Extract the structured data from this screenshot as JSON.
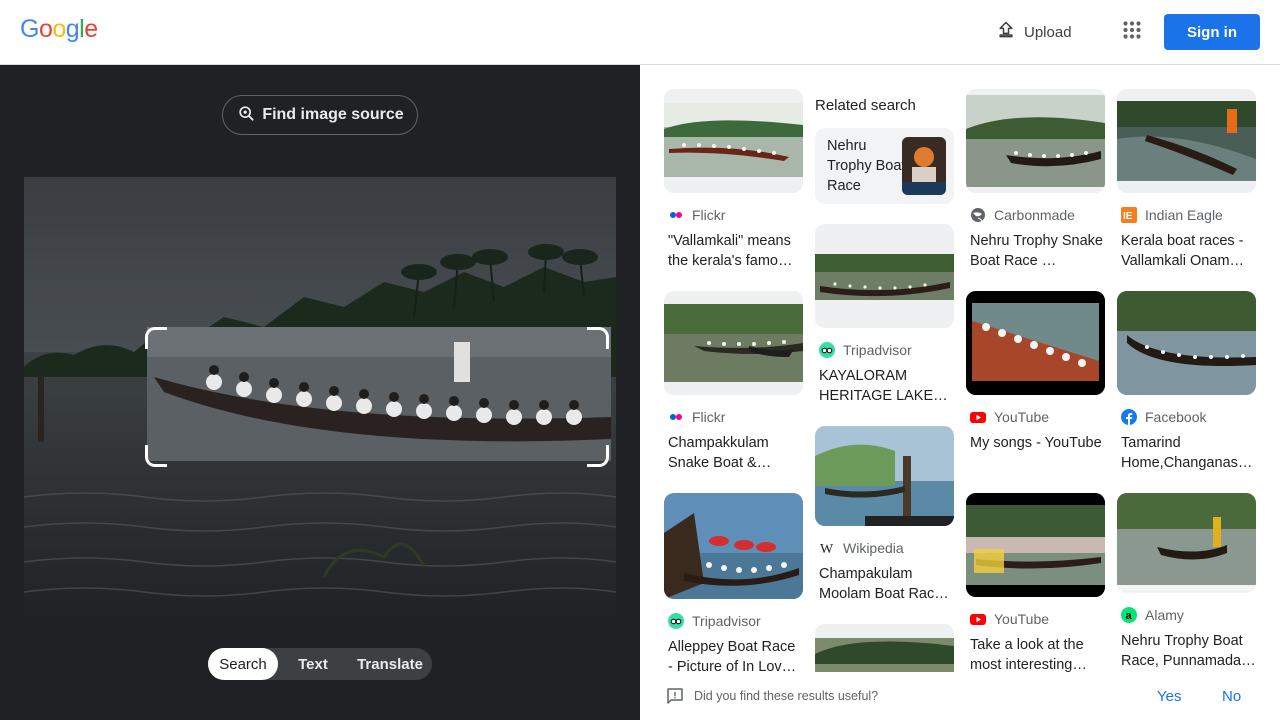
{
  "header": {
    "logo_letters": [
      {
        "ch": "G",
        "color": "#4285f4"
      },
      {
        "ch": "o",
        "color": "#ea4335"
      },
      {
        "ch": "o",
        "color": "#fbbc05"
      },
      {
        "ch": "g",
        "color": "#4285f4"
      },
      {
        "ch": "l",
        "color": "#34a853"
      },
      {
        "ch": "e",
        "color": "#ea4335"
      }
    ],
    "upload_label": "Upload",
    "upload_icon": "upload-icon",
    "apps_icon": "apps-grid-icon",
    "signin_label": "Sign in"
  },
  "left": {
    "find_source_label": "Find image source",
    "find_source_icon": "lens-search-icon",
    "tabs": [
      {
        "label": "Search",
        "active": true
      },
      {
        "label": "Text",
        "active": false
      },
      {
        "label": "Translate",
        "active": false
      }
    ]
  },
  "results": {
    "related_heading": "Related search",
    "related_chip": "Nehru Trophy Boat Race",
    "col1": [
      {
        "source": "Flickr",
        "icon": "flickr-icon",
        "title": "\"Vallamkali\" means the kerala's famo…"
      },
      {
        "source": "Flickr",
        "icon": "flickr-icon",
        "title": "Champakkulam Snake Boat &…"
      },
      {
        "source": "Tripadvisor",
        "icon": "tripadvisor-icon",
        "title": "Alleppey Boat Race - Picture of In Lov…"
      }
    ],
    "col2": [
      {
        "source": "Tripadvisor",
        "icon": "tripadvisor-icon",
        "title": "KAYALORAM HERITAGE LAKE…"
      },
      {
        "source": "Wikipedia",
        "icon": "wikipedia-icon",
        "title": "Champakulam Moolam Boat Rac…"
      }
    ],
    "col3": [
      {
        "source": "Carbonmade",
        "icon": "globe-icon",
        "title": "Nehru Trophy Snake Boat Race …"
      },
      {
        "source": "YouTube",
        "icon": "youtube-icon",
        "title": "My songs - YouTube"
      },
      {
        "source": "YouTube",
        "icon": "youtube-icon",
        "title": "Take a look at the most interesting…"
      }
    ],
    "col4": [
      {
        "source": "Indian Eagle",
        "icon": "indian-eagle-icon",
        "title": "Kerala boat races - Vallamkali Onam…"
      },
      {
        "source": "Facebook",
        "icon": "facebook-icon",
        "title": "Tamarind Home,Changanas…"
      },
      {
        "source": "Alamy",
        "icon": "alamy-icon",
        "title": "Nehru Trophy Boat Race, Punnamada…"
      }
    ]
  },
  "feedback": {
    "question": "Did you find these results useful?",
    "yes": "Yes",
    "no": "No"
  },
  "colors": {
    "accent": "#1a73e8",
    "dark_panel": "#202124"
  }
}
